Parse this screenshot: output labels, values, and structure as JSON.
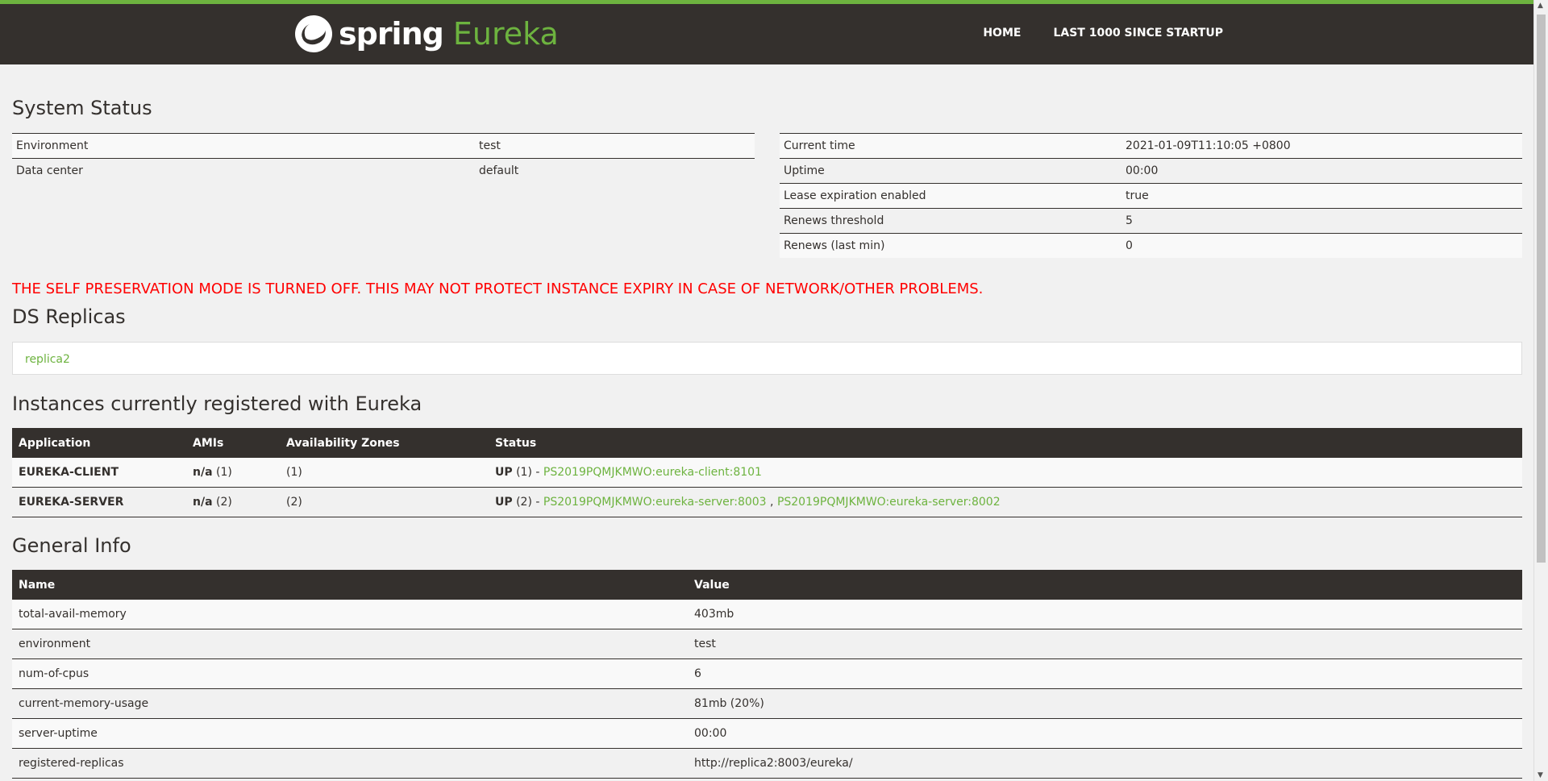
{
  "header": {
    "logo_spring": "spring",
    "logo_eureka": "Eureka",
    "nav": [
      {
        "label": "HOME"
      },
      {
        "label": "LAST 1000 SINCE STARTUP"
      }
    ],
    "accent_color": "#6db33f",
    "bar_color": "#34302d"
  },
  "system_status": {
    "title": "System Status",
    "left": [
      {
        "key": "Environment",
        "value": "test"
      },
      {
        "key": "Data center",
        "value": "default"
      }
    ],
    "right": [
      {
        "key": "Current time",
        "value": "2021-01-09T11:10:05 +0800"
      },
      {
        "key": "Uptime",
        "value": "00:00"
      },
      {
        "key": "Lease expiration enabled",
        "value": "true"
      },
      {
        "key": "Renews threshold",
        "value": "5"
      },
      {
        "key": "Renews (last min)",
        "value": "0"
      }
    ]
  },
  "warning": "THE SELF PRESERVATION MODE IS TURNED OFF. THIS MAY NOT PROTECT INSTANCE EXPIRY IN CASE OF NETWORK/OTHER PROBLEMS.",
  "ds_replicas": {
    "title": "DS Replicas",
    "items": [
      "replica2"
    ]
  },
  "instances": {
    "title": "Instances currently registered with Eureka",
    "columns": [
      "Application",
      "AMIs",
      "Availability Zones",
      "Status"
    ],
    "rows": [
      {
        "application": "EUREKA-CLIENT",
        "ami_bold": "n/a",
        "ami_count": "(1)",
        "zones": "(1)",
        "status_bold": "UP",
        "status_count": "(1) -",
        "links": [
          "PS2019PQMJKMWO:eureka-client:8101"
        ]
      },
      {
        "application": "EUREKA-SERVER",
        "ami_bold": "n/a",
        "ami_count": "(2)",
        "zones": "(2)",
        "status_bold": "UP",
        "status_count": "(2) -",
        "links": [
          "PS2019PQMJKMWO:eureka-server:8003",
          "PS2019PQMJKMWO:eureka-server:8002"
        ]
      }
    ]
  },
  "general_info": {
    "title": "General Info",
    "columns": [
      "Name",
      "Value"
    ],
    "rows": [
      {
        "name": "total-avail-memory",
        "value": "403mb"
      },
      {
        "name": "environment",
        "value": "test"
      },
      {
        "name": "num-of-cpus",
        "value": "6"
      },
      {
        "name": "current-memory-usage",
        "value": "81mb (20%)"
      },
      {
        "name": "server-uptime",
        "value": "00:00"
      },
      {
        "name": "registered-replicas",
        "value": "http://replica2:8003/eureka/"
      }
    ]
  }
}
